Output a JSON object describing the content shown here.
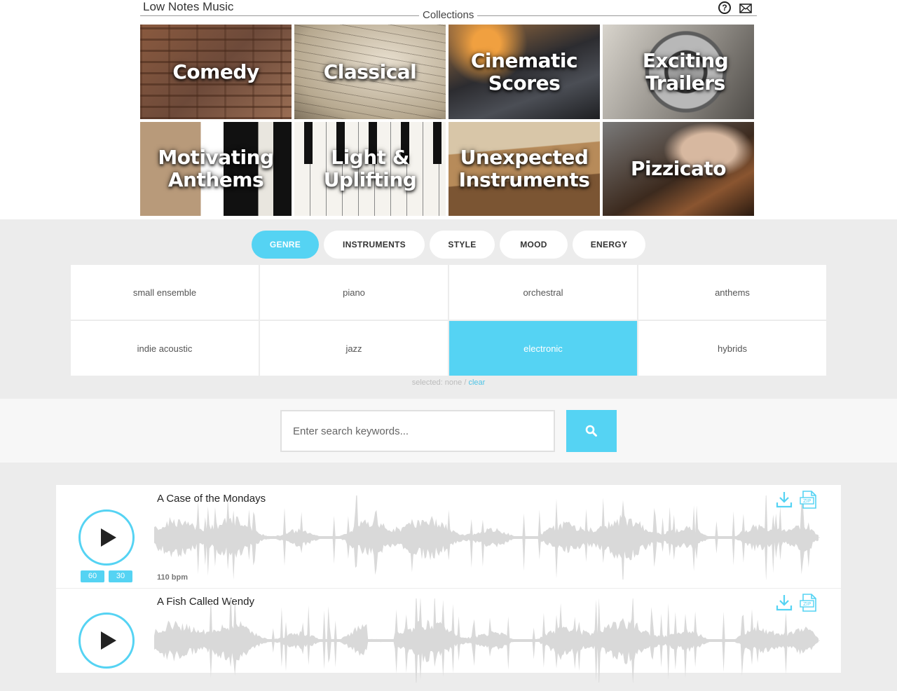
{
  "header": {
    "brand": "Low Notes Music",
    "collections_label": "Collections"
  },
  "collections": [
    {
      "label": "Comedy"
    },
    {
      "label": "Classical"
    },
    {
      "label": "Cinematic Scores"
    },
    {
      "label": "Exciting Trailers"
    },
    {
      "label": "Motivating Anthems"
    },
    {
      "label": "Light & Uplifting"
    },
    {
      "label": "Unexpected Instruments"
    },
    {
      "label": "Pizzicato"
    }
  ],
  "filter_tabs": [
    {
      "label": "GENRE",
      "active": true
    },
    {
      "label": "INSTRUMENTS",
      "active": false
    },
    {
      "label": "STYLE",
      "active": false
    },
    {
      "label": "MOOD",
      "active": false
    },
    {
      "label": "ENERGY",
      "active": false
    }
  ],
  "genres": [
    {
      "label": "small ensemble",
      "selected": false
    },
    {
      "label": "piano",
      "selected": false
    },
    {
      "label": "orchestral",
      "selected": false
    },
    {
      "label": "anthems",
      "selected": false
    },
    {
      "label": "indie acoustic",
      "selected": false
    },
    {
      "label": "jazz",
      "selected": false
    },
    {
      "label": "electronic",
      "selected": true
    },
    {
      "label": "hybrids",
      "selected": false
    }
  ],
  "selection": {
    "text": "selected: none / ",
    "clear_label": "clear"
  },
  "search": {
    "placeholder": "Enter search keywords...",
    "value": ""
  },
  "tracks": [
    {
      "title": "A Case of the Mondays",
      "bpm": "110 bpm",
      "badges": [
        "60",
        "30"
      ]
    },
    {
      "title": "A Fish Called Wendy",
      "bpm": "",
      "badges": []
    }
  ],
  "colors": {
    "accent": "#55d3f3",
    "waveform": "#d9d9d9",
    "page_bg": "#ececec"
  },
  "icons": {
    "help": "question-circle-icon",
    "contact": "envelope-icon",
    "search": "magnifier-icon",
    "play": "play-icon",
    "download": "download-icon",
    "zip": "zip-file-icon"
  }
}
